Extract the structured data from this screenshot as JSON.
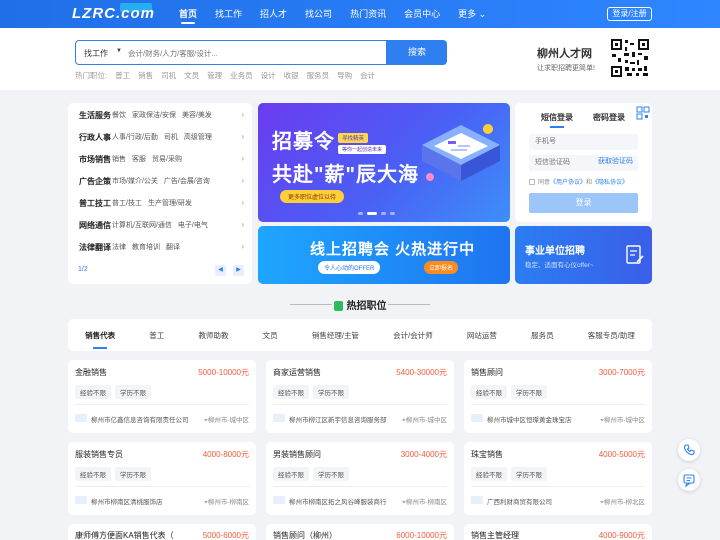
{
  "nav": {
    "logo": "LZRC.com",
    "items": [
      "首页",
      "找工作",
      "招人才",
      "找公司",
      "热门资讯",
      "会员中心",
      "更多"
    ],
    "login": "登录/注册"
  },
  "search": {
    "type": "找工作",
    "placeholder": "会计/财务/人力/客服/设计...",
    "button": "搜索",
    "hot_label": "热门职位:",
    "hot": [
      "普工",
      "销售",
      "司机",
      "文员",
      "管理",
      "业务员",
      "设计",
      "收银",
      "服务员",
      "导购",
      "会计"
    ]
  },
  "brand": {
    "name": "柳州人才网",
    "slogan": "让求职招聘更简单!"
  },
  "categories": [
    {
      "title": "生活服务",
      "subs": [
        "餐饮",
        "家政保洁/安保",
        "美容/美发"
      ]
    },
    {
      "title": "行政人事",
      "subs": [
        "人事/行政/后勤",
        "司机",
        "高级管理"
      ]
    },
    {
      "title": "市场销售",
      "subs": [
        "销售",
        "客服",
        "贸易/采购"
      ]
    },
    {
      "title": "广告企策",
      "subs": [
        "市场/媒介/公关",
        "广告/会展/咨询"
      ]
    },
    {
      "title": "普工技工",
      "subs": [
        "普工/技工",
        "生产管理/研发"
      ]
    },
    {
      "title": "网络通信",
      "subs": [
        "计算机/互联网/通信",
        "电子/电气"
      ]
    },
    {
      "title": "法律翻译",
      "subs": [
        "法律",
        "教育培训",
        "翻译"
      ]
    }
  ],
  "pager": "1/2",
  "banner1": {
    "line1": "招募令",
    "line2": "共赴\"薪\"辰大海",
    "tag1": "寻找精英",
    "tag2": "等你一起创造未来",
    "button": "更多职位虚位以待"
  },
  "banner2": {
    "title": "线上招聘会 火热进行中",
    "subtitle": "令人心动的OFFER",
    "button": "立即报名"
  },
  "login": {
    "tab_sms": "短信登录",
    "tab_pwd": "密码登录",
    "phone_placeholder": "手机号",
    "code_placeholder": "短信验证码",
    "get_code": "获取验证码",
    "agree_prefix": "同意",
    "agreement1": "《用户协议》",
    "agree_and": "和",
    "agreement2": "《隐私协议》",
    "submit": "登录"
  },
  "gov": {
    "title": "事业单位招聘",
    "subtitle": "稳定、适面有心仪offer~"
  },
  "section_title": "热招职位",
  "tabs": [
    "销售代表",
    "普工",
    "教师助教",
    "文员",
    "销售经理/主管",
    "会计/会计师",
    "网站运营",
    "服务员",
    "客服专员/助理"
  ],
  "jobs": [
    {
      "title": "金融销售",
      "salary": "5000-10000元",
      "tags": [
        "经验不限",
        "学历不限"
      ],
      "company": "柳州市亿鑫信息咨询有限责任公司",
      "location": "柳州市-城中区"
    },
    {
      "title": "商家运营销售",
      "salary": "5400-30000元",
      "tags": [
        "经验不限",
        "学历不限"
      ],
      "company": "柳州市柳江区新宇信息咨询服务部",
      "location": "柳州市-城中区"
    },
    {
      "title": "销售顾问",
      "salary": "3000-7000元",
      "tags": [
        "经验不限",
        "学历不限"
      ],
      "company": "柳州市城中区恒璨黄金珠宝店",
      "location": "柳州市-城中区"
    },
    {
      "title": "服装销售专员",
      "salary": "4000-8000元",
      "tags": [
        "经验不限",
        "学历不限"
      ],
      "company": "柳州市柳南区清桃服饰店",
      "location": "柳州市-柳南区"
    },
    {
      "title": "男装销售顾问",
      "salary": "3000-4000元",
      "tags": [
        "经验不限",
        "学历不限"
      ],
      "company": "柳州市柳南区拓之风谷峰服装商行",
      "location": "柳州市-柳南区"
    },
    {
      "title": "珠宝销售",
      "salary": "4000-5000元",
      "tags": [
        "经验不限",
        "学历不限"
      ],
      "company": "广西利财商贸有限公司",
      "location": "柳州市-柳北区"
    },
    {
      "title": "康师傅方便面KA销售代表（",
      "salary": "5000-6000元",
      "tags": [],
      "company": "",
      "location": ""
    },
    {
      "title": "销售顾问（柳州）",
      "salary": "6000-10000元",
      "tags": [],
      "company": "",
      "location": ""
    },
    {
      "title": "销售主管经理",
      "salary": "4000-9000元",
      "tags": [],
      "company": "",
      "location": ""
    }
  ],
  "colors": {
    "primary": "#2f7ff0",
    "salary": "#f25a3c",
    "hot_icon": "#2dbb5d"
  }
}
